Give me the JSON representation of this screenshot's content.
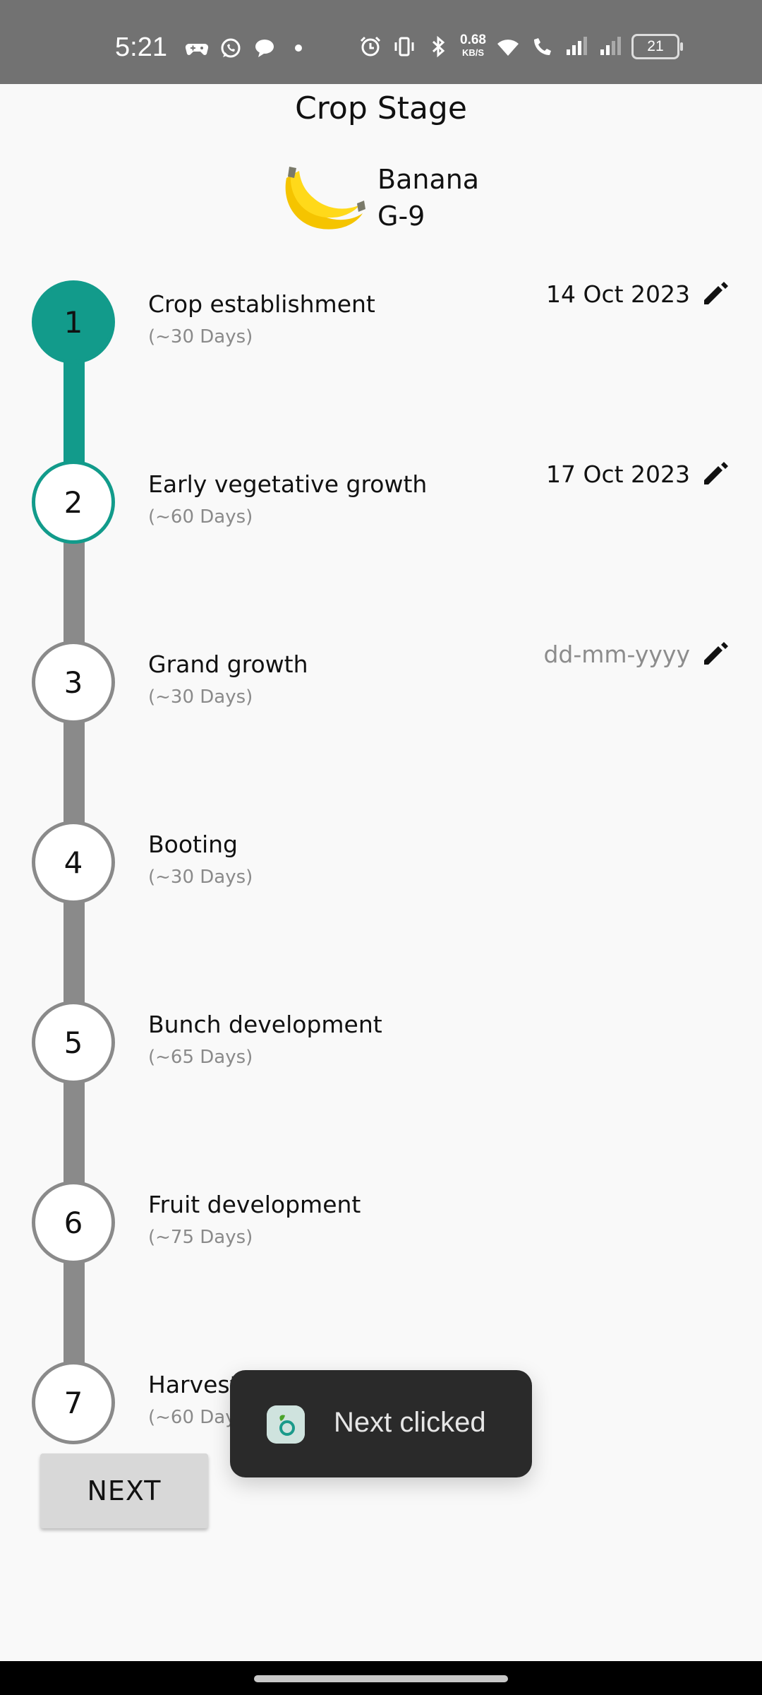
{
  "status_bar": {
    "time": "5:21",
    "net_speed_value": "0.68",
    "net_speed_unit": "KB/S",
    "battery": "21"
  },
  "header": {
    "title": "Crop Stage",
    "crop_name": "Banana",
    "crop_variety": "G-9"
  },
  "stages": [
    {
      "number": "1",
      "name": "Crop establishment",
      "duration": "(~30 Days)",
      "date": "14 Oct 2023",
      "state": "done"
    },
    {
      "number": "2",
      "name": "Early vegetative growth",
      "duration": "(~60 Days)",
      "date": "17 Oct 2023",
      "state": "current"
    },
    {
      "number": "3",
      "name": "Grand growth",
      "duration": "(~30 Days)",
      "date": "dd-mm-yyyy",
      "state": "pending"
    },
    {
      "number": "4",
      "name": "Booting",
      "duration": "(~30 Days)",
      "date": "",
      "state": "pending"
    },
    {
      "number": "5",
      "name": "Bunch development",
      "duration": "(~65 Days)",
      "date": "",
      "state": "pending"
    },
    {
      "number": "6",
      "name": "Fruit development",
      "duration": "(~75 Days)",
      "date": "",
      "state": "pending"
    },
    {
      "number": "7",
      "name": "Harvest",
      "duration": "(~60 Days)",
      "date": "",
      "state": "pending"
    }
  ],
  "next_button": {
    "label": "NEXT"
  },
  "toast": {
    "message": "Next clicked"
  },
  "colors": {
    "accent": "#129b8b",
    "inactive": "#8a8a8a"
  }
}
